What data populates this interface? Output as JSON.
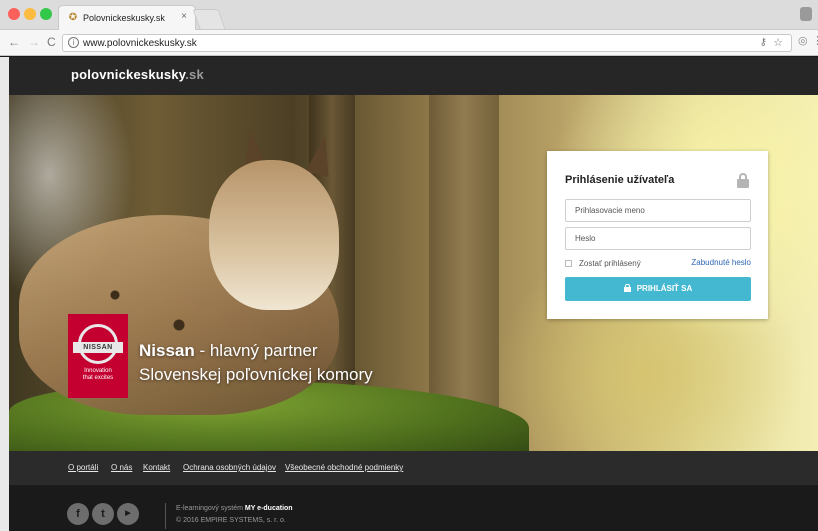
{
  "browser": {
    "tab_title": "Polovnickeskusky.sk",
    "tab_close": "×",
    "url": "www.polovnickeskusky.sk"
  },
  "site": {
    "logo_main": "polovnickeskusky",
    "logo_tld": ".sk"
  },
  "login": {
    "title": "Prihlásenie užívateľa",
    "username_placeholder": "Prihlasovacie meno",
    "password_placeholder": "Heslo",
    "remember_label": "Zostať prihlásený",
    "forgot_label": "Zabudnuté heslo",
    "submit_label": "PRIHLÁSIŤ SA"
  },
  "partner": {
    "brand": "Nissan",
    "line1_rest": " - hlavný partner",
    "line2": "Slovenskej poľovníckej komory",
    "badge_name": "NISSAN",
    "badge_tagline_1": "Innovation",
    "badge_tagline_2": "that excites"
  },
  "footer": {
    "links": [
      "O portáli",
      "O nás",
      "Kontakt",
      "Ochrana osobných údajov",
      "Všeobecné obchodné podmienky"
    ],
    "elearning_prefix": "E-learningový systém ",
    "elearning_brand": "MY e-ducation",
    "copyright": "© 2016 EMPIRE SYSTEMS, s. r. o.",
    "social": [
      "facebook-icon",
      "twitter-icon",
      "youtube-icon"
    ]
  },
  "colors": {
    "accent": "#45b8d1",
    "header_bg": "#262626",
    "nissan_red": "#c3002f",
    "link_blue": "#2f66b3"
  }
}
